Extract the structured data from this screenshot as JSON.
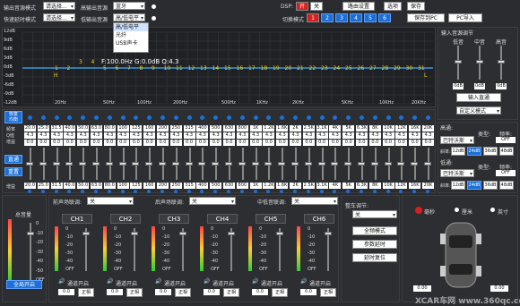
{
  "top_bar": {
    "output_source_mode_label": "输出音源模式",
    "output_source_mode_value": "请选择...",
    "high_output_source_label": "高输出音源",
    "high_output_source_value": "蓝牙",
    "quick_delay_mode_label": "快速延时模式",
    "quick_delay_mode_value": "请选择...",
    "low_output_source_label": "低输出音源",
    "low_output_source_value": "高/低电平",
    "dropdown_options": [
      "高/低电平",
      "光纤",
      "USB声卡"
    ],
    "dsp_label": "DSP:",
    "dsp_on": "开",
    "dsp_off": "关",
    "router_settings": "路由设置",
    "options": "选项",
    "save": "保存",
    "switch_mode_label": "切换模式",
    "mode_buttons": [
      "1",
      "2",
      "3",
      "4",
      "5",
      "6"
    ],
    "save_to_pc": "保存到PC",
    "pc_import": "PC导入"
  },
  "graph": {
    "y_ticks": [
      "12dB",
      "9dB",
      "6dB",
      "3dB",
      "0dB",
      "-3dB",
      "-6dB",
      "-9dB",
      "-12dB"
    ],
    "x_ticks": [
      "20Hz",
      "50Hz",
      "100Hz",
      "200Hz",
      "500Hz",
      "1KHz",
      "2KHz",
      "5KHz",
      "10KHz",
      "20KHz"
    ],
    "readout": "F:100.0Hz  G:0.0dB  Q:4.3",
    "band_markers": [
      "1",
      "2",
      "3",
      "4",
      "5",
      "6",
      "7",
      "8",
      "9",
      "10",
      "11",
      "12",
      "13",
      "14",
      "15",
      "16",
      "17",
      "18",
      "19",
      "20",
      "21",
      "22",
      "23",
      "24",
      "25",
      "26",
      "27",
      "28",
      "29",
      "30",
      "31"
    ],
    "h_marker": "H",
    "l_marker": "L"
  },
  "eq_table": {
    "restore_label": "恢复\n均衡",
    "row_labels": [
      "频率",
      "Q值",
      "增益"
    ],
    "q_value": "4.3",
    "gain_value": "0.0",
    "link_button": "直通",
    "reset_button": "重置",
    "bottom_label": "增益",
    "bottom_values": [
      "20.0",
      "25.0",
      "31.5",
      "40.0",
      "50.0",
      "63.0",
      "80.0",
      "100",
      "125",
      "160",
      "200",
      "250",
      "315",
      "400",
      "500",
      "630",
      "800",
      "1K",
      "1.2K",
      "1.6K",
      "2K",
      "2.5K",
      "3.1K",
      "4K",
      "5K",
      "6.3K",
      "8K",
      "10K",
      "12K",
      "16K",
      "20K"
    ]
  },
  "input_panel": {
    "title": "输入音源调节",
    "labels": [
      "低音",
      "中音",
      "高音"
    ],
    "values": [
      "0dB",
      "0dB",
      "0dB"
    ],
    "input_direct": "输入直通",
    "phase_select": "自定义模式"
  },
  "crossover": {
    "high_pass_label": "高通:",
    "type_label": "类型:",
    "freq_label": "频率:",
    "slope_label": "斜率:",
    "hp_type": "巴特沃斯",
    "hp_freq": "OFF",
    "hp_slopes": [
      "12dB",
      "24dB",
      "36dB",
      "48dB"
    ],
    "low_pass_label": "低通:",
    "lp_type": "巴特沃斯",
    "lp_freq": "OFF",
    "lp_slopes": [
      "12dB",
      "24dB",
      "36dB",
      "48dB"
    ]
  },
  "master": {
    "title": "总音量",
    "scale": [
      "0",
      "-10",
      "-20",
      "-30",
      "-40",
      "-50",
      "OFF"
    ],
    "mute_all": "全局开启"
  },
  "channels": {
    "front_label": "前声场联调:",
    "front_value": "关",
    "rear_label": "后声场联调:",
    "rear_value": "关",
    "mid_label": "中低音联调:",
    "mid_value": "关",
    "channel_names": [
      "CH1",
      "CH2",
      "CH3",
      "CH4",
      "CH5",
      "CH6"
    ],
    "channel_values": [
      "0.0",
      "0.0",
      "0.0",
      "0.0",
      "0.0",
      "0.0"
    ],
    "mute_label": "通道开启",
    "phase_label": "正相",
    "scale": [
      "0",
      "-10",
      "-20",
      "-30",
      "-40",
      "OFF"
    ]
  },
  "tuning": {
    "title": "整车调节:",
    "mode_value": "关",
    "buttons": [
      "全频模式",
      "参数延时",
      "延时复位"
    ]
  },
  "units": {
    "options": [
      "毫秒",
      "厘米",
      "英寸"
    ],
    "value": "0.00"
  },
  "watermark": "XCAR车网 www.360qc.com",
  "colors": {
    "accent_blue": "#1c6fd6",
    "eq_line": "#3fb0ff",
    "marker_yellow": "#f4d21a",
    "dsp_red": "#d42020"
  }
}
